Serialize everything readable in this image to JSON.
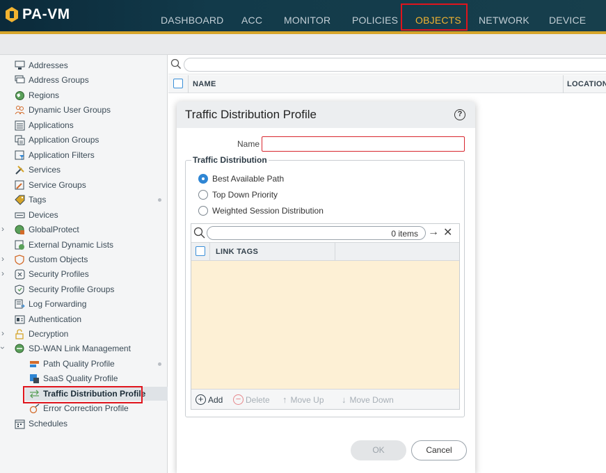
{
  "app": {
    "title": "PA-VM"
  },
  "nav": {
    "tabs": [
      "DASHBOARD",
      "ACC",
      "MONITOR",
      "POLICIES",
      "OBJECTS",
      "NETWORK",
      "DEVICE"
    ],
    "active": "OBJECTS"
  },
  "sidebar": {
    "items": [
      {
        "label": "Addresses",
        "icon": "addresses-icon"
      },
      {
        "label": "Address Groups",
        "icon": "address-groups-icon"
      },
      {
        "label": "Regions",
        "icon": "globe-icon"
      },
      {
        "label": "Dynamic User Groups",
        "icon": "user-group-icon"
      },
      {
        "label": "Applications",
        "icon": "applications-icon"
      },
      {
        "label": "Application Groups",
        "icon": "application-groups-icon"
      },
      {
        "label": "Application Filters",
        "icon": "application-filters-icon"
      },
      {
        "label": "Services",
        "icon": "services-icon"
      },
      {
        "label": "Service Groups",
        "icon": "service-groups-icon"
      },
      {
        "label": "Tags",
        "icon": "tag-icon"
      },
      {
        "label": "Devices",
        "icon": "devices-icon"
      },
      {
        "label": "GlobalProtect",
        "icon": "globalprotect-icon"
      },
      {
        "label": "External Dynamic Lists",
        "icon": "external-list-icon"
      },
      {
        "label": "Custom Objects",
        "icon": "custom-objects-icon"
      },
      {
        "label": "Security Profiles",
        "icon": "security-profiles-icon"
      },
      {
        "label": "Security Profile Groups",
        "icon": "security-profile-groups-icon"
      },
      {
        "label": "Log Forwarding",
        "icon": "log-forwarding-icon"
      },
      {
        "label": "Authentication",
        "icon": "authentication-icon"
      },
      {
        "label": "Decryption",
        "icon": "decryption-icon"
      },
      {
        "label": "SD-WAN Link Management",
        "icon": "sdwan-icon"
      },
      {
        "label": "Path Quality Profile",
        "icon": "path-quality-icon"
      },
      {
        "label": "SaaS Quality Profile",
        "icon": "saas-quality-icon"
      },
      {
        "label": "Traffic Distribution Profile",
        "icon": "traffic-distribution-icon"
      },
      {
        "label": "Error Correction Profile",
        "icon": "error-correction-icon"
      },
      {
        "label": "Schedules",
        "icon": "schedules-icon"
      }
    ]
  },
  "table": {
    "columns": [
      "NAME",
      "LOCATION"
    ]
  },
  "dialog": {
    "title": "Traffic Distribution Profile",
    "help": "?",
    "name_label": "Name",
    "name_value": "",
    "section_title": "Traffic Distribution",
    "options": [
      "Best Available Path",
      "Top Down Priority",
      "Weighted Session Distribution"
    ],
    "selected_option": "Best Available Path",
    "grid": {
      "count": "0 items",
      "column": "LINK TAGS",
      "rows": []
    },
    "footer_buttons": {
      "add": "Add",
      "delete": "Delete",
      "move_up": "Move Up",
      "move_down": "Move Down"
    },
    "ok": "OK",
    "cancel": "Cancel"
  },
  "colors": {
    "header_bg": "#123a4a",
    "accent_gold": "#d6a52a",
    "highlight_red": "#e0141c",
    "radio_blue": "#2f86d4",
    "grid_body": "#fdf0d5"
  }
}
